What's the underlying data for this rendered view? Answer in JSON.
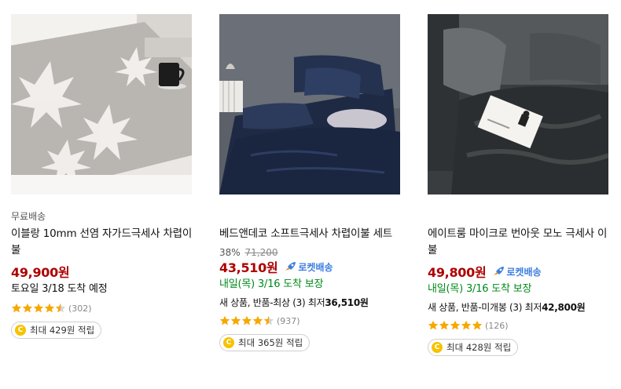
{
  "products": [
    {
      "shipping_badge": "무료배송",
      "title": "이블랑 10mm 선염 자가드극세사 차렵이불",
      "discount_rate": "",
      "original_price": "",
      "price": "49,900원",
      "rocket": "",
      "delivery": "토요일 3/18 도착 예정",
      "used_label": "",
      "used_price": "",
      "rating_value": 4.5,
      "review_count": "(302)",
      "reward": "최대 429원 적립",
      "coin": "C"
    },
    {
      "shipping_badge": "",
      "title": "베드앤데코 소프트극세사 차렵이불 세트",
      "discount_rate": "38%",
      "original_price": "71,200",
      "price": "43,510원",
      "rocket": "로켓배송",
      "delivery": "내일(목) 3/16 도착 보장",
      "used_label": "새 상품, 반품-최상 (3) 최저",
      "used_price": "36,510원",
      "rating_value": 4.5,
      "review_count": "(937)",
      "reward": "최대 365원 적립",
      "coin": "C"
    },
    {
      "shipping_badge": "",
      "title": "에이트룸 마이크로 번아웃 모노 극세사 이불",
      "discount_rate": "",
      "original_price": "",
      "price": "49,800원",
      "rocket": "로켓배송",
      "delivery": "내일(목) 3/16 도착 보장",
      "used_label": "새 상품, 반품-미개봉 (3) 최저",
      "used_price": "42,800원",
      "rating_value": 5,
      "review_count": "(126)",
      "reward": "최대 428원 적립",
      "coin": "C"
    }
  ],
  "colors": {
    "price": "#ae0000",
    "delivery_green": "#00891a",
    "rocket_blue": "#3b7ee0",
    "star": "#f6a800",
    "coin": "#f5c300"
  }
}
